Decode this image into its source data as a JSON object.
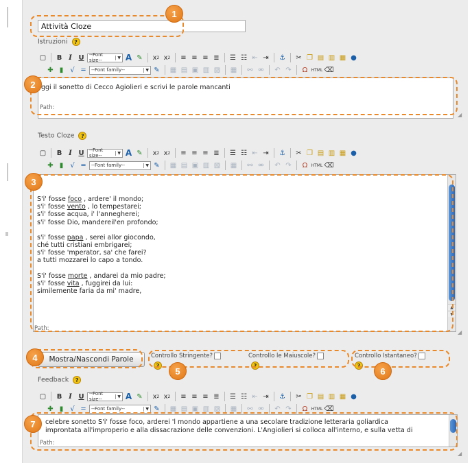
{
  "title_field": {
    "value": "Attività Cloze"
  },
  "sections": {
    "istruzioni": "Istruzioni",
    "testo_cloze": "Testo Cloze",
    "feedback": "Feedback"
  },
  "help_glyph": "?",
  "toolbar": {
    "bold": "B",
    "italic": "I",
    "underline": "U",
    "font_size": "--Font size--",
    "font_family": "--Font family--",
    "subscript": "x",
    "superscript": "x",
    "text_color": "A",
    "omega": "Ω",
    "html": "HTML"
  },
  "istruzioni_editor": {
    "text": "ggi il sonetto di Cecco Agiolieri e scrivi le parole mancanti",
    "path": "Path:"
  },
  "cloze_editor": {
    "lines": [
      [
        "S'i' fosse ",
        "foco",
        " , ardere' il mondo;"
      ],
      [
        "s'i' fosse ",
        "vento",
        " , lo tempestarei;"
      ],
      [
        "s'i' fosse acqua, i' l'annegherei;",
        "",
        ""
      ],
      [
        "s'i' fosse Dio, mandereil'en profondo;",
        "",
        ""
      ],
      [
        "",
        "",
        ""
      ],
      [
        "s'i' fosse ",
        "papa",
        " , serei allor giocondo,"
      ],
      [
        "ché tutti cristiani embrigarei;",
        "",
        ""
      ],
      [
        "s'i' fosse 'mperator, sa' che farei?",
        "",
        ""
      ],
      [
        "a tutti mozzarei lo capo a tondo.",
        "",
        ""
      ],
      [
        "",
        "",
        ""
      ],
      [
        "S'i' fosse ",
        "morte",
        " , andarei da mio padre;"
      ],
      [
        "s'i' fosse ",
        "vita",
        " , fuggirei da lui:"
      ],
      [
        "similemente faria da mi' madre,",
        "",
        ""
      ]
    ],
    "path": "Path:"
  },
  "options": {
    "toggle_button": "Mostra/Nascondi Parole",
    "controllo_stringente": "Controllo Stringente?",
    "controllo_maiuscole": "Controllo le Maiuscole?",
    "controllo_istantaneo": "Controllo Istantaneo?"
  },
  "feedback_editor": {
    "line1": "celebre sonetto S'i' fosse foco, arderei 'l mondo appartiene a una secolare tradizione letteraria goliardica",
    "line2": "improntata all'improperio e alla dissacrazione delle convenzioni. L'Angiolieri si colloca all'interno, e sulla vetta di",
    "path": "Path:"
  },
  "callouts": [
    "1",
    "2",
    "3",
    "4",
    "5",
    "6",
    "7"
  ],
  "colors": {
    "callout_orange": "#e8892b",
    "panel_bg": "#ececec",
    "scroll_blue": "#2c69b8"
  }
}
